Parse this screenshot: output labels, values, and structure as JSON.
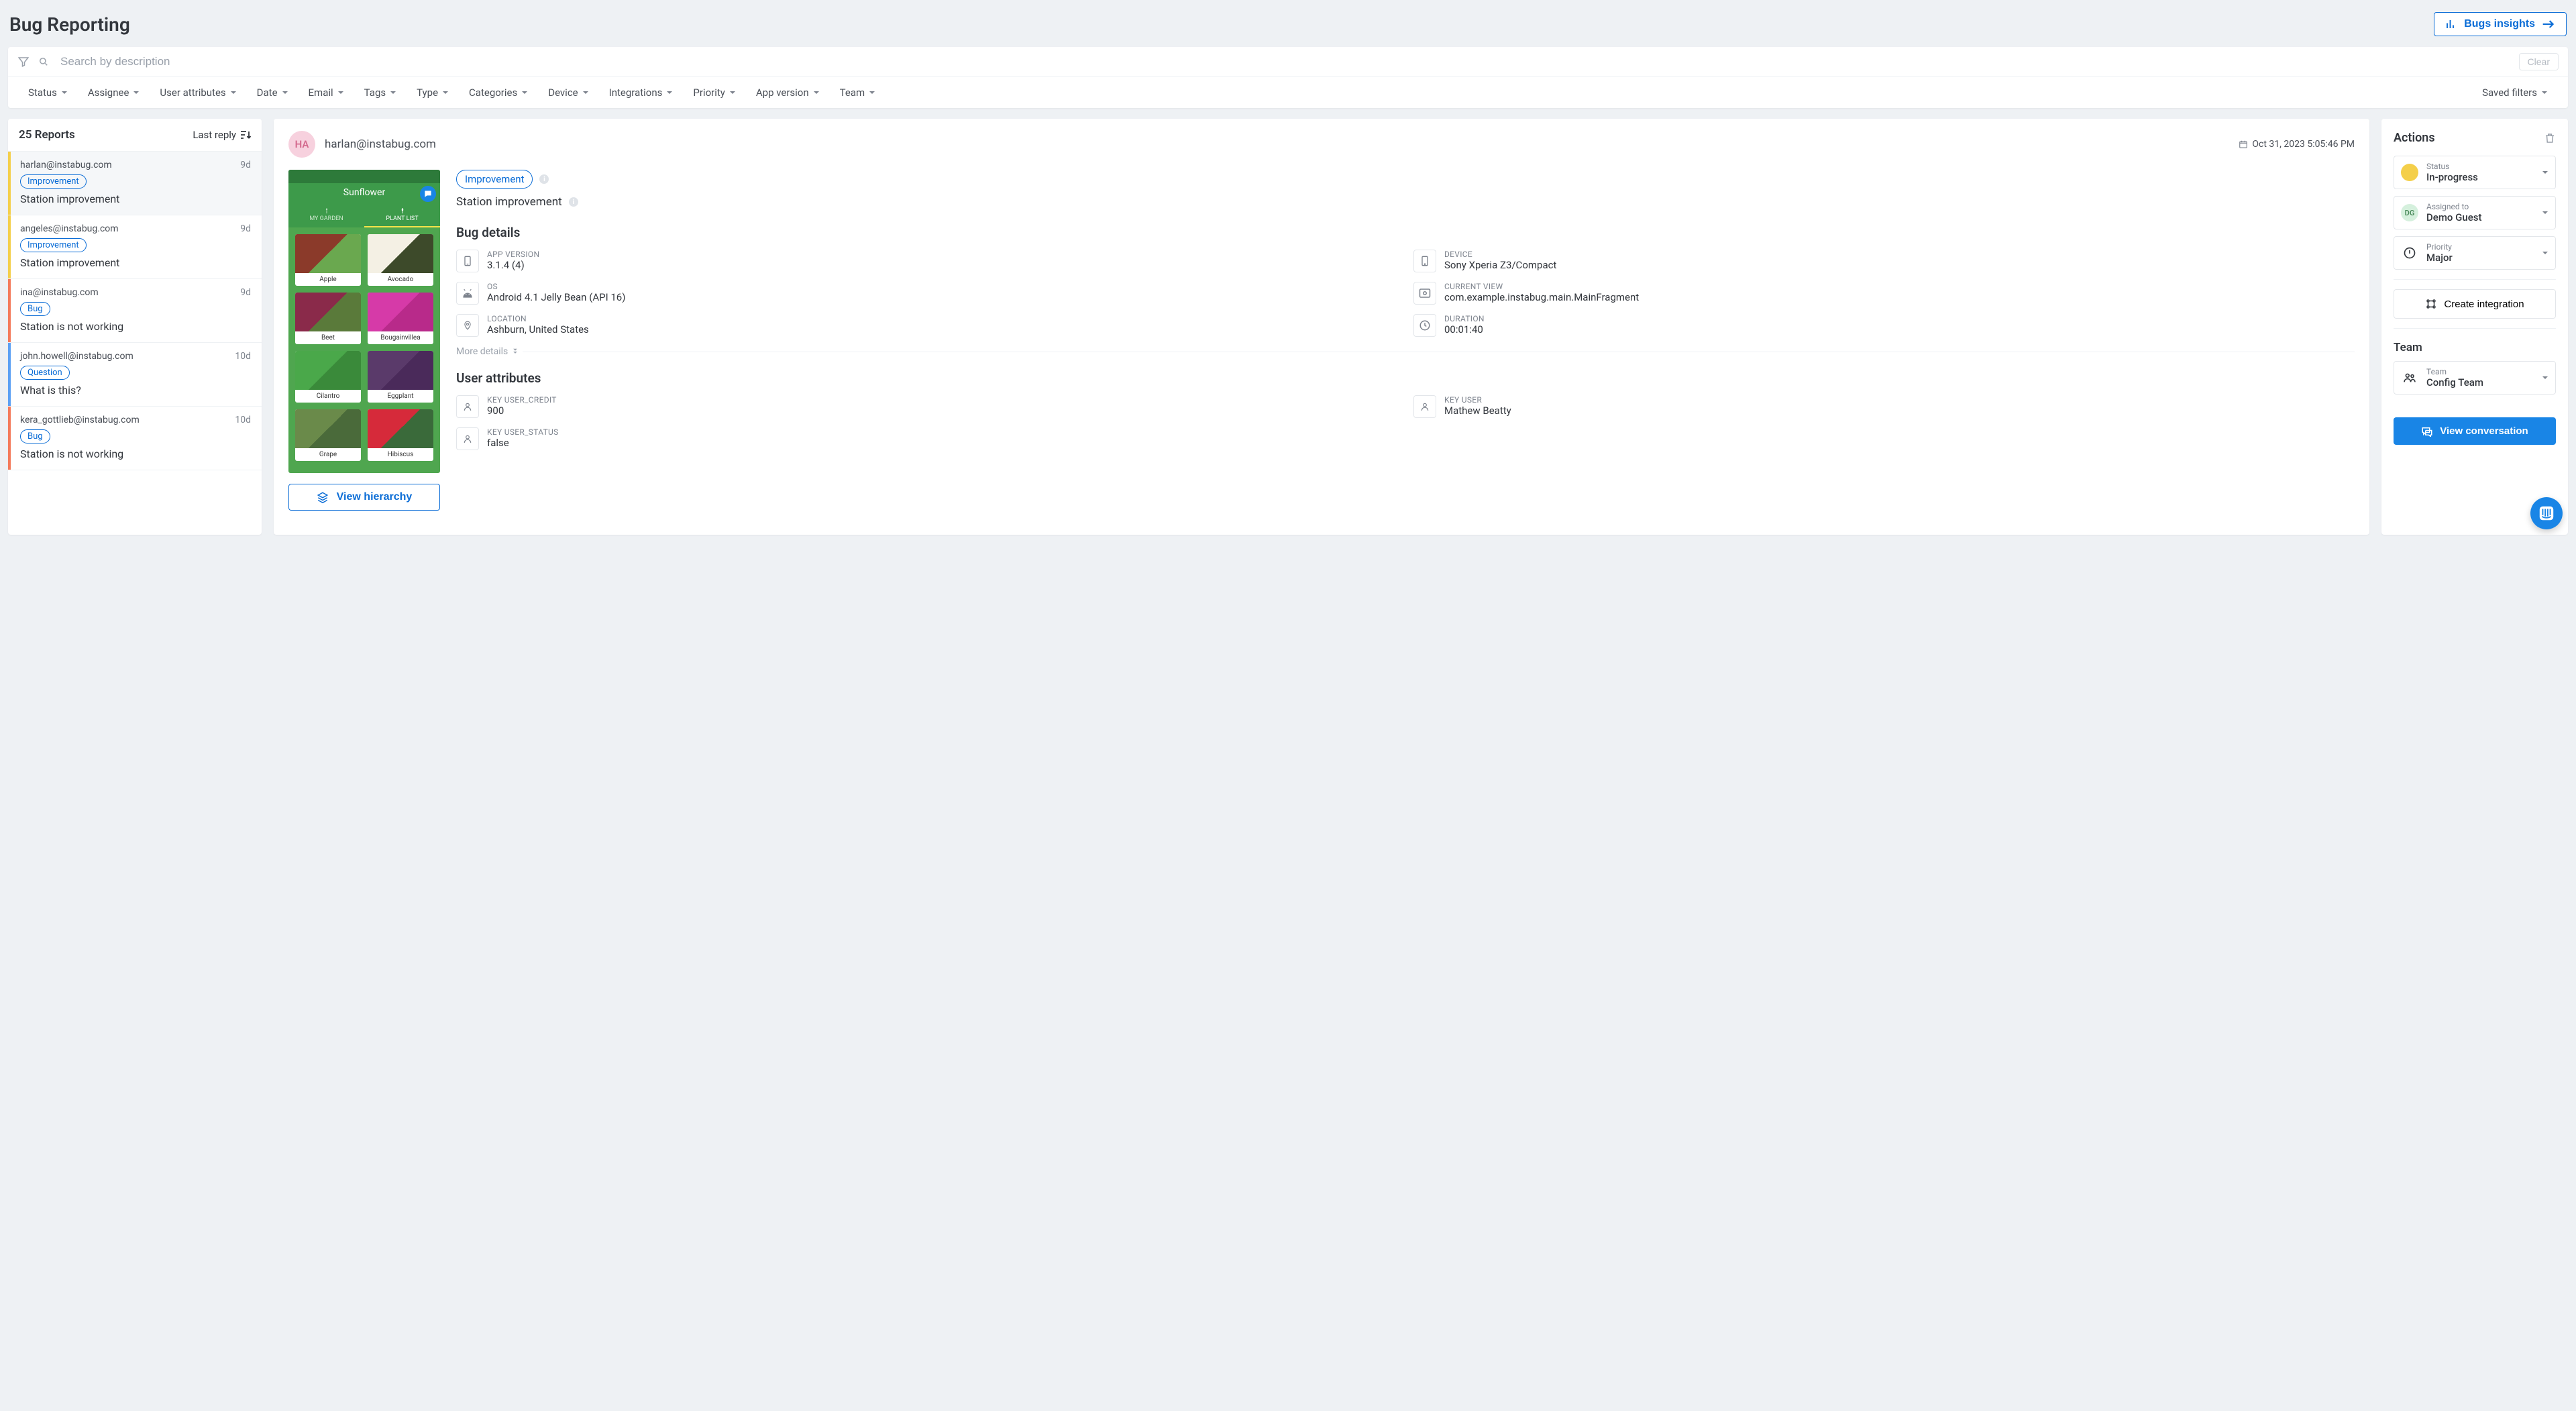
{
  "header": {
    "title": "Bug Reporting",
    "insights_label": "Bugs insights"
  },
  "search": {
    "placeholder": "Search by description",
    "clear_label": "Clear"
  },
  "filters": {
    "items": [
      "Status",
      "Assignee",
      "User attributes",
      "Date",
      "Email",
      "Tags",
      "Type",
      "Categories",
      "Device",
      "Integrations",
      "Priority",
      "App version",
      "Team"
    ],
    "saved_filters_label": "Saved filters"
  },
  "reports": {
    "count_label": "25 Reports",
    "sort_label": "Last reply",
    "items": [
      {
        "email": "harlan@instabug.com",
        "time": "9d",
        "tag": "Improvement",
        "title": "Station improvement",
        "color": "#f4cf4a",
        "selected": true
      },
      {
        "email": "angeles@instabug.com",
        "time": "9d",
        "tag": "Improvement",
        "title": "Station improvement",
        "color": "#f4cf4a",
        "selected": false
      },
      {
        "email": "ina@instabug.com",
        "time": "9d",
        "tag": "Bug",
        "title": "Station is not working",
        "color": "#f47a5a",
        "selected": false
      },
      {
        "email": "john.howell@instabug.com",
        "time": "10d",
        "tag": "Question",
        "title": "What is this?",
        "color": "#5aa0f4",
        "selected": false
      },
      {
        "email": "kera_gottlieb@instabug.com",
        "time": "10d",
        "tag": "Bug",
        "title": "Station is not working",
        "color": "#f47a5a",
        "selected": false
      }
    ]
  },
  "detail": {
    "user_initials": "HA",
    "user_email": "harlan@instabug.com",
    "timestamp": "Oct 31, 2023 5:05:46 PM",
    "type_pill": "Improvement",
    "summary": "Station improvement",
    "screenshot": {
      "app_title": "Sunflower",
      "tab1": "MY GARDEN",
      "tab2": "PLANT LIST",
      "plants": [
        {
          "name": "Apple",
          "c1": "#8b3a2a",
          "c2": "#6aa84f"
        },
        {
          "name": "Avocado",
          "c1": "#f4f0e4",
          "c2": "#3d4a2a"
        },
        {
          "name": "Beet",
          "c1": "#8a2a4a",
          "c2": "#5a7a3a"
        },
        {
          "name": "Bougainvillea",
          "c1": "#d63aa8",
          "c2": "#b82a8a"
        },
        {
          "name": "Cilantro",
          "c1": "#4aa84a",
          "c2": "#3a8a3a"
        },
        {
          "name": "Eggplant",
          "c1": "#5a3a6a",
          "c2": "#4a2a5a"
        },
        {
          "name": "Grape",
          "c1": "#6a8a4a",
          "c2": "#4a6a3a"
        },
        {
          "name": "Hibiscus",
          "c1": "#d62a3a",
          "c2": "#3a6a3a"
        }
      ]
    },
    "view_hierarchy_label": "View hierarchy",
    "bug_details_heading": "Bug details",
    "details": {
      "app_version": {
        "label": "APP VERSION",
        "value": "3.1.4 (4)"
      },
      "device": {
        "label": "DEVICE",
        "value": "Sony Xperia Z3/Compact"
      },
      "os": {
        "label": "OS",
        "value": "Android 4.1 Jelly Bean (API 16)"
      },
      "current_view": {
        "label": "CURRENT VIEW",
        "value": "com.example.instabug.main.MainFragment"
      },
      "location": {
        "label": "LOCATION",
        "value": "Ashburn, United States"
      },
      "duration": {
        "label": "DURATION",
        "value": "00:01:40"
      }
    },
    "more_details_label": "More details",
    "user_attributes_heading": "User attributes",
    "user_attrs": {
      "user_credit": {
        "label": "KEY USER_CREDIT",
        "value": "900"
      },
      "user": {
        "label": "KEY USER",
        "value": "Mathew Beatty"
      },
      "user_status": {
        "label": "KEY USER_STATUS",
        "value": "false"
      }
    }
  },
  "actions": {
    "heading": "Actions",
    "status": {
      "label": "Status",
      "value": "In-progress",
      "color": "#f4cf4a"
    },
    "assigned": {
      "label": "Assigned to",
      "value": "Demo Guest",
      "initials": "DG",
      "bg": "#d5f0dd",
      "fg": "#4a8a5a"
    },
    "priority": {
      "label": "Priority",
      "value": "Major"
    },
    "create_integration_label": "Create integration",
    "team_heading": "Team",
    "team": {
      "label": "Team",
      "value": "Config Team"
    },
    "view_conversation_label": "View conversation"
  }
}
